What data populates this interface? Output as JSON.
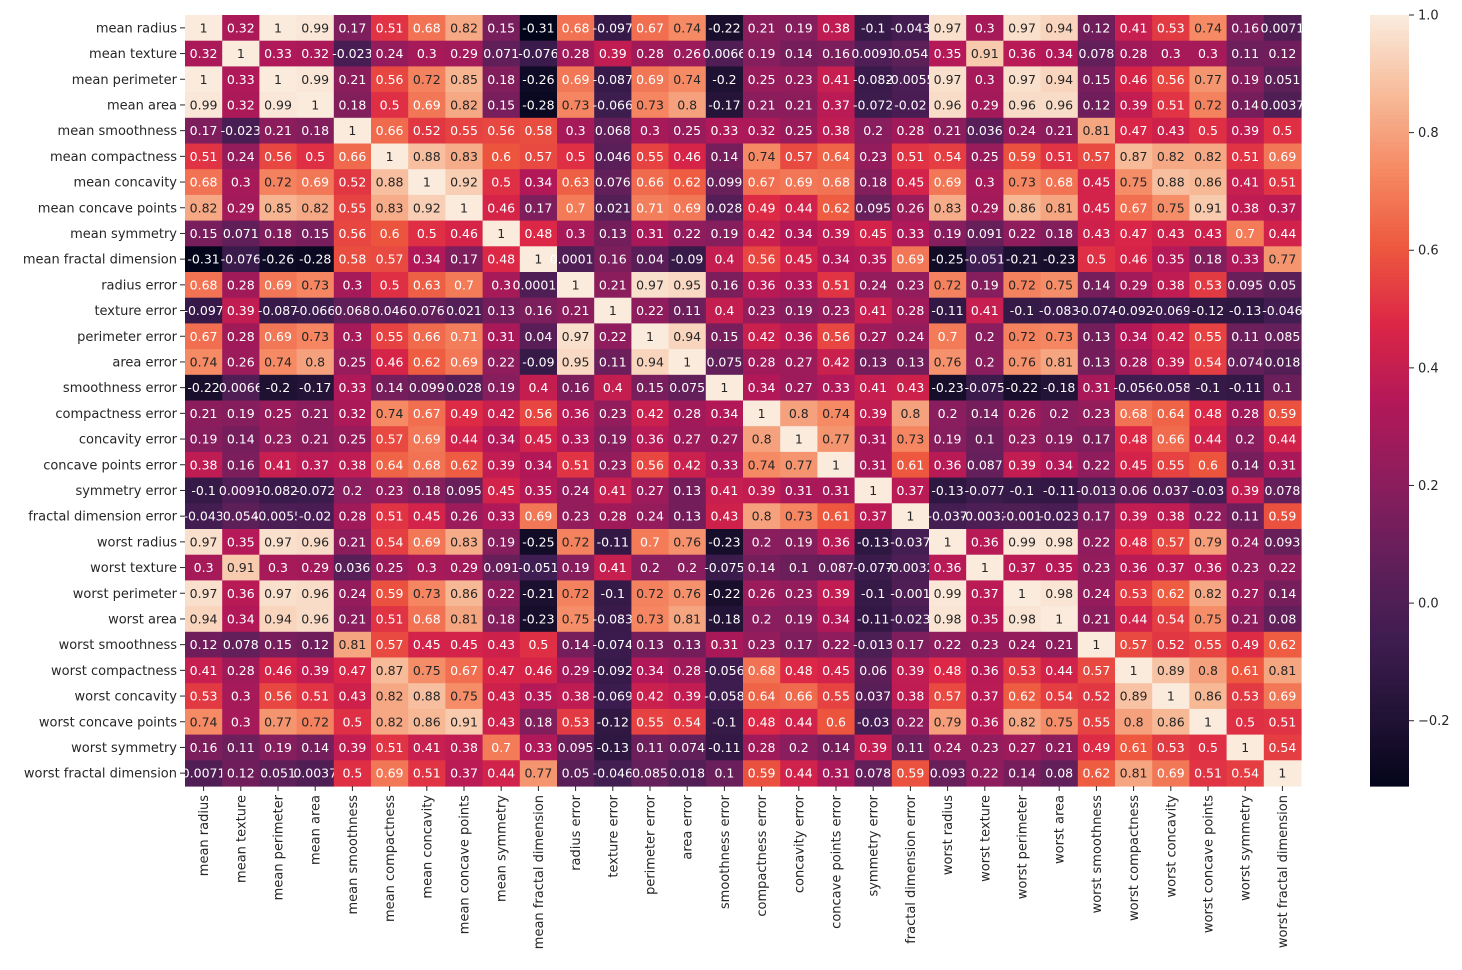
{
  "chart_data": {
    "type": "heatmap",
    "title": "",
    "xlabel": "",
    "ylabel": "",
    "colormap": "rocket",
    "vmin": -0.311,
    "vmax": 1.0,
    "colorbar": {
      "ticks": [
        1.0,
        0.8,
        0.6,
        0.4,
        0.2,
        0.0,
        -0.2
      ],
      "tick_labels": [
        "1.0",
        "0.8",
        "0.6",
        "0.4",
        "0.2",
        "0.0",
        "−0.2"
      ],
      "placement": "right"
    },
    "labels": [
      "mean radius",
      "mean texture",
      "mean perimeter",
      "mean area",
      "mean smoothness",
      "mean compactness",
      "mean concavity",
      "mean concave points",
      "mean symmetry",
      "mean fractal dimension",
      "radius error",
      "texture error",
      "perimeter error",
      "area error",
      "smoothness error",
      "compactness error",
      "concavity error",
      "concave points error",
      "symmetry error",
      "fractal dimension error",
      "worst radius",
      "worst texture",
      "worst perimeter",
      "worst area",
      "worst smoothness",
      "worst compactness",
      "worst concavity",
      "worst concave points",
      "worst symmetry",
      "worst fractal dimension"
    ],
    "matrix": [
      [
        "1",
        "0.32",
        "1",
        "0.99",
        "0.17",
        "0.51",
        "0.68",
        "0.82",
        "0.15",
        "-0.31",
        "0.68",
        "-0.097",
        "0.67",
        "0.74",
        "-0.22",
        "0.21",
        "0.19",
        "0.38",
        "-0.1",
        "-0.043",
        "0.97",
        "0.3",
        "0.97",
        "0.94",
        "0.12",
        "0.41",
        "0.53",
        "0.74",
        "0.16",
        "0.0071"
      ],
      [
        "0.32",
        "1",
        "0.33",
        "0.32",
        "-0.023",
        "0.24",
        "0.3",
        "0.29",
        "0.071",
        "-0.076",
        "0.28",
        "0.39",
        "0.28",
        "0.26",
        "0.0066",
        "0.19",
        "0.14",
        "0.16",
        "0.0091",
        "0.054",
        "0.35",
        "0.91",
        "0.36",
        "0.34",
        "0.078",
        "0.28",
        "0.3",
        "0.3",
        "0.11",
        "0.12"
      ],
      [
        "1",
        "0.33",
        "1",
        "0.99",
        "0.21",
        "0.56",
        "0.72",
        "0.85",
        "0.18",
        "-0.26",
        "0.69",
        "-0.087",
        "0.69",
        "0.74",
        "-0.2",
        "0.25",
        "0.23",
        "0.41",
        "-0.082",
        "-0.0055",
        "0.97",
        "0.3",
        "0.97",
        "0.94",
        "0.15",
        "0.46",
        "0.56",
        "0.77",
        "0.19",
        "0.051"
      ],
      [
        "0.99",
        "0.32",
        "0.99",
        "1",
        "0.18",
        "0.5",
        "0.69",
        "0.82",
        "0.15",
        "-0.28",
        "0.73",
        "-0.066",
        "0.73",
        "0.8",
        "-0.17",
        "0.21",
        "0.21",
        "0.37",
        "-0.072",
        "-0.02",
        "0.96",
        "0.29",
        "0.96",
        "0.96",
        "0.12",
        "0.39",
        "0.51",
        "0.72",
        "0.14",
        "0.0037"
      ],
      [
        "0.17",
        "-0.023",
        "0.21",
        "0.18",
        "1",
        "0.66",
        "0.52",
        "0.55",
        "0.56",
        "0.58",
        "0.3",
        "0.068",
        "0.3",
        "0.25",
        "0.33",
        "0.32",
        "0.25",
        "0.38",
        "0.2",
        "0.28",
        "0.21",
        "0.036",
        "0.24",
        "0.21",
        "0.81",
        "0.47",
        "0.43",
        "0.5",
        "0.39",
        "0.5"
      ],
      [
        "0.51",
        "0.24",
        "0.56",
        "0.5",
        "0.66",
        "1",
        "0.88",
        "0.83",
        "0.6",
        "0.57",
        "0.5",
        "0.046",
        "0.55",
        "0.46",
        "0.14",
        "0.74",
        "0.57",
        "0.64",
        "0.23",
        "0.51",
        "0.54",
        "0.25",
        "0.59",
        "0.51",
        "0.57",
        "0.87",
        "0.82",
        "0.82",
        "0.51",
        "0.69"
      ],
      [
        "0.68",
        "0.3",
        "0.72",
        "0.69",
        "0.52",
        "0.88",
        "1",
        "0.92",
        "0.5",
        "0.34",
        "0.63",
        "0.076",
        "0.66",
        "0.62",
        "0.099",
        "0.67",
        "0.69",
        "0.68",
        "0.18",
        "0.45",
        "0.69",
        "0.3",
        "0.73",
        "0.68",
        "0.45",
        "0.75",
        "0.88",
        "0.86",
        "0.41",
        "0.51"
      ],
      [
        "0.82",
        "0.29",
        "0.85",
        "0.82",
        "0.55",
        "0.83",
        "0.92",
        "1",
        "0.46",
        "0.17",
        "0.7",
        "0.021",
        "0.71",
        "0.69",
        "0.028",
        "0.49",
        "0.44",
        "0.62",
        "0.095",
        "0.26",
        "0.83",
        "0.29",
        "0.86",
        "0.81",
        "0.45",
        "0.67",
        "0.75",
        "0.91",
        "0.38",
        "0.37"
      ],
      [
        "0.15",
        "0.071",
        "0.18",
        "0.15",
        "0.56",
        "0.6",
        "0.5",
        "0.46",
        "1",
        "0.48",
        "0.3",
        "0.13",
        "0.31",
        "0.22",
        "0.19",
        "0.42",
        "0.34",
        "0.39",
        "0.45",
        "0.33",
        "0.19",
        "0.091",
        "0.22",
        "0.18",
        "0.43",
        "0.47",
        "0.43",
        "0.43",
        "0.7",
        "0.44"
      ],
      [
        "-0.31",
        "-0.076",
        "-0.26",
        "-0.28",
        "0.58",
        "0.57",
        "0.34",
        "0.17",
        "0.48",
        "1",
        "0.00011",
        "0.16",
        "0.04",
        "-0.09",
        "0.4",
        "0.56",
        "0.45",
        "0.34",
        "0.35",
        "0.69",
        "-0.25",
        "-0.051",
        "-0.21",
        "-0.23",
        "0.5",
        "0.46",
        "0.35",
        "0.18",
        "0.33",
        "0.77"
      ],
      [
        "0.68",
        "0.28",
        "0.69",
        "0.73",
        "0.3",
        "0.5",
        "0.63",
        "0.7",
        "0.3",
        "0.00011",
        "1",
        "0.21",
        "0.97",
        "0.95",
        "0.16",
        "0.36",
        "0.33",
        "0.51",
        "0.24",
        "0.23",
        "0.72",
        "0.19",
        "0.72",
        "0.75",
        "0.14",
        "0.29",
        "0.38",
        "0.53",
        "0.095",
        "0.05"
      ],
      [
        "-0.097",
        "0.39",
        "-0.087",
        "-0.066",
        "0.068",
        "0.046",
        "0.076",
        "0.021",
        "0.13",
        "0.16",
        "0.21",
        "1",
        "0.22",
        "0.11",
        "0.4",
        "0.23",
        "0.19",
        "0.23",
        "0.41",
        "0.28",
        "-0.11",
        "0.41",
        "-0.1",
        "-0.083",
        "-0.074",
        "-0.092",
        "-0.069",
        "-0.12",
        "-0.13",
        "-0.046"
      ],
      [
        "0.67",
        "0.28",
        "0.69",
        "0.73",
        "0.3",
        "0.55",
        "0.66",
        "0.71",
        "0.31",
        "0.04",
        "0.97",
        "0.22",
        "1",
        "0.94",
        "0.15",
        "0.42",
        "0.36",
        "0.56",
        "0.27",
        "0.24",
        "0.7",
        "0.2",
        "0.72",
        "0.73",
        "0.13",
        "0.34",
        "0.42",
        "0.55",
        "0.11",
        "0.085"
      ],
      [
        "0.74",
        "0.26",
        "0.74",
        "0.8",
        "0.25",
        "0.46",
        "0.62",
        "0.69",
        "0.22",
        "-0.09",
        "0.95",
        "0.11",
        "0.94",
        "1",
        "0.075",
        "0.28",
        "0.27",
        "0.42",
        "0.13",
        "0.13",
        "0.76",
        "0.2",
        "0.76",
        "0.81",
        "0.13",
        "0.28",
        "0.39",
        "0.54",
        "0.074",
        "0.018"
      ],
      [
        "-0.22",
        "0.0066",
        "-0.2",
        "-0.17",
        "0.33",
        "0.14",
        "0.099",
        "0.028",
        "0.19",
        "0.4",
        "0.16",
        "0.4",
        "0.15",
        "0.075",
        "1",
        "0.34",
        "0.27",
        "0.33",
        "0.41",
        "0.43",
        "-0.23",
        "-0.075",
        "-0.22",
        "-0.18",
        "0.31",
        "-0.056",
        "-0.058",
        "-0.1",
        "-0.11",
        "0.1"
      ],
      [
        "0.21",
        "0.19",
        "0.25",
        "0.21",
        "0.32",
        "0.74",
        "0.67",
        "0.49",
        "0.42",
        "0.56",
        "0.36",
        "0.23",
        "0.42",
        "0.28",
        "0.34",
        "1",
        "0.8",
        "0.74",
        "0.39",
        "0.8",
        "0.2",
        "0.14",
        "0.26",
        "0.2",
        "0.23",
        "0.68",
        "0.64",
        "0.48",
        "0.28",
        "0.59"
      ],
      [
        "0.19",
        "0.14",
        "0.23",
        "0.21",
        "0.25",
        "0.57",
        "0.69",
        "0.44",
        "0.34",
        "0.45",
        "0.33",
        "0.19",
        "0.36",
        "0.27",
        "0.27",
        "0.8",
        "1",
        "0.77",
        "0.31",
        "0.73",
        "0.19",
        "0.1",
        "0.23",
        "0.19",
        "0.17",
        "0.48",
        "0.66",
        "0.44",
        "0.2",
        "0.44"
      ],
      [
        "0.38",
        "0.16",
        "0.41",
        "0.37",
        "0.38",
        "0.64",
        "0.68",
        "0.62",
        "0.39",
        "0.34",
        "0.51",
        "0.23",
        "0.56",
        "0.42",
        "0.33",
        "0.74",
        "0.77",
        "1",
        "0.31",
        "0.61",
        "0.36",
        "0.087",
        "0.39",
        "0.34",
        "0.22",
        "0.45",
        "0.55",
        "0.6",
        "0.14",
        "0.31"
      ],
      [
        "-0.1",
        "0.0091",
        "-0.082",
        "-0.072",
        "0.2",
        "0.23",
        "0.18",
        "0.095",
        "0.45",
        "0.35",
        "0.24",
        "0.41",
        "0.27",
        "0.13",
        "0.41",
        "0.39",
        "0.31",
        "0.31",
        "1",
        "0.37",
        "-0.13",
        "-0.077",
        "-0.1",
        "-0.11",
        "-0.013",
        "0.06",
        "0.037",
        "-0.03",
        "0.39",
        "0.078"
      ],
      [
        "-0.043",
        "0.054",
        "-0.0055",
        "-0.02",
        "0.28",
        "0.51",
        "0.45",
        "0.26",
        "0.33",
        "0.69",
        "0.23",
        "0.28",
        "0.24",
        "0.13",
        "0.43",
        "0.8",
        "0.73",
        "0.61",
        "0.37",
        "1",
        "-0.037",
        "-0.0032",
        "-0.001",
        "-0.023",
        "0.17",
        "0.39",
        "0.38",
        "0.22",
        "0.11",
        "0.59"
      ],
      [
        "0.97",
        "0.35",
        "0.97",
        "0.96",
        "0.21",
        "0.54",
        "0.69",
        "0.83",
        "0.19",
        "-0.25",
        "0.72",
        "-0.11",
        "0.7",
        "0.76",
        "-0.23",
        "0.2",
        "0.19",
        "0.36",
        "-0.13",
        "-0.037",
        "1",
        "0.36",
        "0.99",
        "0.98",
        "0.22",
        "0.48",
        "0.57",
        "0.79",
        "0.24",
        "0.093"
      ],
      [
        "0.3",
        "0.91",
        "0.3",
        "0.29",
        "0.036",
        "0.25",
        "0.3",
        "0.29",
        "0.091",
        "-0.051",
        "0.19",
        "0.41",
        "0.2",
        "0.2",
        "-0.075",
        "0.14",
        "0.1",
        "0.087",
        "-0.077",
        "-0.0032",
        "0.36",
        "1",
        "0.37",
        "0.35",
        "0.23",
        "0.36",
        "0.37",
        "0.36",
        "0.23",
        "0.22"
      ],
      [
        "0.97",
        "0.36",
        "0.97",
        "0.96",
        "0.24",
        "0.59",
        "0.73",
        "0.86",
        "0.22",
        "-0.21",
        "0.72",
        "-0.1",
        "0.72",
        "0.76",
        "-0.22",
        "0.26",
        "0.23",
        "0.39",
        "-0.1",
        "-0.001",
        "0.99",
        "0.37",
        "1",
        "0.98",
        "0.24",
        "0.53",
        "0.62",
        "0.82",
        "0.27",
        "0.14"
      ],
      [
        "0.94",
        "0.34",
        "0.94",
        "0.96",
        "0.21",
        "0.51",
        "0.68",
        "0.81",
        "0.18",
        "-0.23",
        "0.75",
        "-0.083",
        "0.73",
        "0.81",
        "-0.18",
        "0.2",
        "0.19",
        "0.34",
        "-0.11",
        "-0.023",
        "0.98",
        "0.35",
        "0.98",
        "1",
        "0.21",
        "0.44",
        "0.54",
        "0.75",
        "0.21",
        "0.08"
      ],
      [
        "0.12",
        "0.078",
        "0.15",
        "0.12",
        "0.81",
        "0.57",
        "0.45",
        "0.45",
        "0.43",
        "0.5",
        "0.14",
        "-0.074",
        "0.13",
        "0.13",
        "0.31",
        "0.23",
        "0.17",
        "0.22",
        "-0.013",
        "0.17",
        "0.22",
        "0.23",
        "0.24",
        "0.21",
        "1",
        "0.57",
        "0.52",
        "0.55",
        "0.49",
        "0.62"
      ],
      [
        "0.41",
        "0.28",
        "0.46",
        "0.39",
        "0.47",
        "0.87",
        "0.75",
        "0.67",
        "0.47",
        "0.46",
        "0.29",
        "-0.092",
        "0.34",
        "0.28",
        "-0.056",
        "0.68",
        "0.48",
        "0.45",
        "0.06",
        "0.39",
        "0.48",
        "0.36",
        "0.53",
        "0.44",
        "0.57",
        "1",
        "0.89",
        "0.8",
        "0.61",
        "0.81"
      ],
      [
        "0.53",
        "0.3",
        "0.56",
        "0.51",
        "0.43",
        "0.82",
        "0.88",
        "0.75",
        "0.43",
        "0.35",
        "0.38",
        "-0.069",
        "0.42",
        "0.39",
        "-0.058",
        "0.64",
        "0.66",
        "0.55",
        "0.037",
        "0.38",
        "0.57",
        "0.37",
        "0.62",
        "0.54",
        "0.52",
        "0.89",
        "1",
        "0.86",
        "0.53",
        "0.69"
      ],
      [
        "0.74",
        "0.3",
        "0.77",
        "0.72",
        "0.5",
        "0.82",
        "0.86",
        "0.91",
        "0.43",
        "0.18",
        "0.53",
        "-0.12",
        "0.55",
        "0.54",
        "-0.1",
        "0.48",
        "0.44",
        "0.6",
        "-0.03",
        "0.22",
        "0.79",
        "0.36",
        "0.82",
        "0.75",
        "0.55",
        "0.8",
        "0.86",
        "1",
        "0.5",
        "0.51"
      ],
      [
        "0.16",
        "0.11",
        "0.19",
        "0.14",
        "0.39",
        "0.51",
        "0.41",
        "0.38",
        "0.7",
        "0.33",
        "0.095",
        "-0.13",
        "0.11",
        "0.074",
        "-0.11",
        "0.28",
        "0.2",
        "0.14",
        "0.39",
        "0.11",
        "0.24",
        "0.23",
        "0.27",
        "0.21",
        "0.49",
        "0.61",
        "0.53",
        "0.5",
        "1",
        "0.54"
      ],
      [
        "0.0071",
        "0.12",
        "0.051",
        "0.0037",
        "0.5",
        "0.69",
        "0.51",
        "0.37",
        "0.44",
        "0.77",
        "0.05",
        "-0.046",
        "0.085",
        "0.018",
        "0.1",
        "0.59",
        "0.44",
        "0.31",
        "0.078",
        "0.59",
        "0.093",
        "0.22",
        "0.14",
        "0.08",
        "0.62",
        "0.81",
        "0.69",
        "0.51",
        "0.54",
        "1"
      ]
    ]
  }
}
